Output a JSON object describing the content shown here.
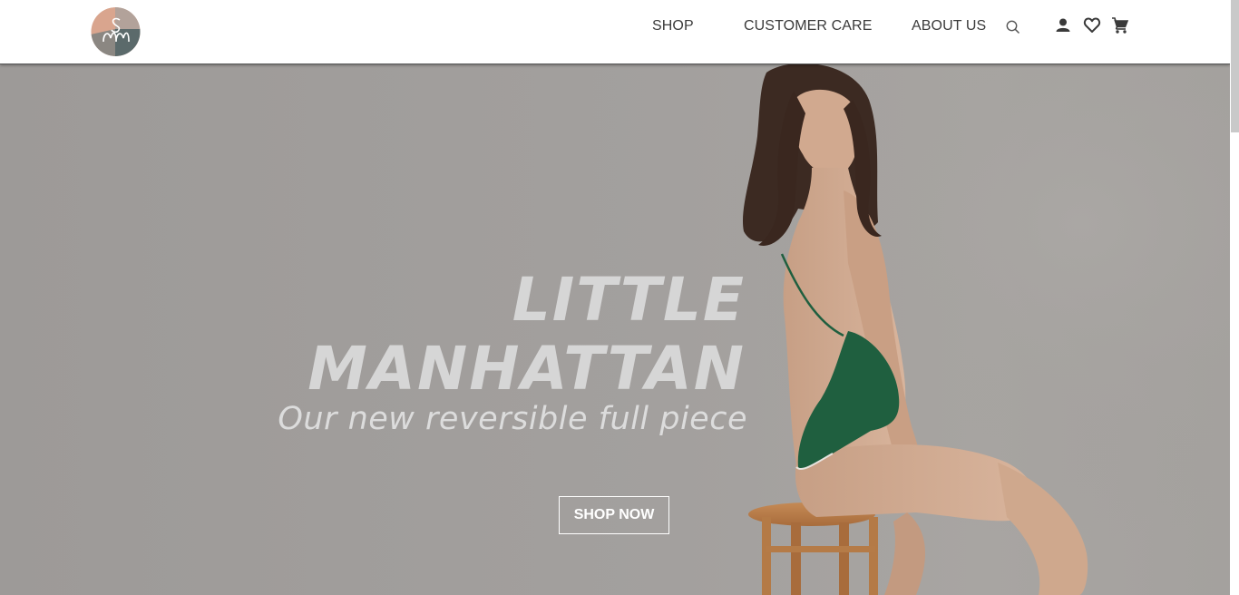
{
  "header": {
    "logo_text": "SM",
    "nav": {
      "shop": "SHOP",
      "customer_care": "CUSTOMER CARE",
      "about_us": "ABOUT US"
    },
    "icons": [
      "search-icon",
      "user-icon",
      "heart-icon",
      "cart-icon"
    ]
  },
  "hero": {
    "title_line1": "LITTLE",
    "title_line2": "MANHATTAN",
    "subtitle": "Our new reversible full piece",
    "cta_label": "SHOP NOW"
  },
  "colors": {
    "hero_background": "#a19e9b",
    "hero_text": "#d6d6d6",
    "swimsuit": "#1f5f3f",
    "logo_peach": "#d9a58e",
    "logo_slate": "#5b6a6b"
  }
}
